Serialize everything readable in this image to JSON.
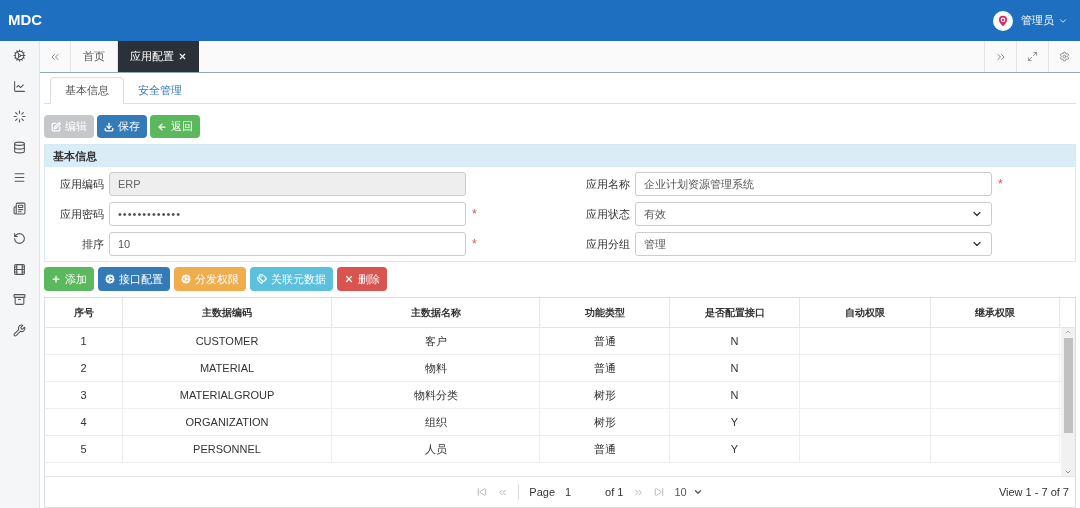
{
  "header": {
    "logo": "MDC",
    "user": "管理员"
  },
  "page_tabs": [
    {
      "label": "首页",
      "selected": false,
      "closable": false
    },
    {
      "label": "应用配置",
      "selected": true,
      "closable": true
    }
  ],
  "sub_tabs": [
    {
      "label": "基本信息",
      "selected": true
    },
    {
      "label": "安全管理",
      "selected": false
    }
  ],
  "toolbar": [
    {
      "kind": "edit",
      "label": "编辑",
      "disabled": true
    },
    {
      "kind": "save",
      "label": "保存",
      "disabled": false
    },
    {
      "kind": "back",
      "label": "返回",
      "disabled": false
    }
  ],
  "section": {
    "title": "基本信息"
  },
  "form": [
    {
      "label": "应用编码",
      "kind": "text",
      "value": "ERP",
      "readonly": true
    },
    {
      "label": "应用名称",
      "kind": "text",
      "value": "企业计划资源管理系统",
      "readonly": false,
      "required_mark": "*"
    },
    {
      "label": "应用密码",
      "kind": "password",
      "value": "•••••••••••••",
      "readonly": false,
      "required_mark": "*"
    },
    {
      "label": "应用状态",
      "kind": "select",
      "value": "有效",
      "readonly": false
    },
    {
      "label": "排序",
      "kind": "text",
      "value": "10",
      "readonly": false,
      "required_mark": "*"
    },
    {
      "label": "应用分组",
      "kind": "select",
      "value": "管理",
      "readonly": false
    }
  ],
  "actions": [
    {
      "kind": "add",
      "label": "添加"
    },
    {
      "kind": "config",
      "label": "接口配置"
    },
    {
      "kind": "permission",
      "label": "分发权限"
    },
    {
      "kind": "link",
      "label": "关联元数据"
    },
    {
      "kind": "delete",
      "label": "删除"
    }
  ],
  "table": {
    "columns": [
      "序号",
      "主数据编码",
      "主数据名称",
      "功能类型",
      "是否配置接口",
      "自动权限",
      "继承权限"
    ],
    "rows": [
      [
        "1",
        "CUSTOMER",
        "客户",
        "普通",
        "N",
        "",
        ""
      ],
      [
        "2",
        "MATERIAL",
        "物料",
        "普通",
        "N",
        "",
        ""
      ],
      [
        "3",
        "MATERIALGROUP",
        "物料分类",
        "树形",
        "N",
        "",
        ""
      ],
      [
        "4",
        "ORGANIZATION",
        "组织",
        "树形",
        "Y",
        "",
        ""
      ],
      [
        "5",
        "PERSONNEL",
        "人员",
        "普通",
        "Y",
        "",
        ""
      ]
    ]
  },
  "pager": {
    "page_label": "Page",
    "page": "1",
    "of": "of 1",
    "page_size": "10",
    "view": "View 1 - 7 of 7"
  }
}
